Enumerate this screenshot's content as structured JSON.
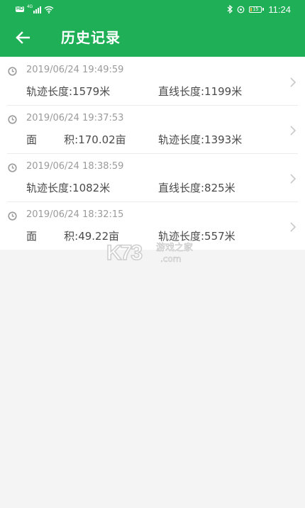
{
  "statusbar": {
    "left_icons": [
      "hd-badge",
      "4g-signal-icon",
      "wifi-icon"
    ],
    "hd_label": "HD",
    "network_label": "4G",
    "right_icons": [
      "bluetooth-icon",
      "location-icon",
      "battery-icon"
    ],
    "battery_level": "15",
    "battery_fraction": 0.15,
    "battery_color": "#f2b84b",
    "time": "11:24"
  },
  "appbar": {
    "back_icon": "arrow-left-icon",
    "title": "历史记录",
    "background": "#1faf57"
  },
  "records": [
    {
      "timestamp": "2019/06/24 19:49:59",
      "field1": "轨迹长度:1579米",
      "field2": "直线长度:1199米"
    },
    {
      "timestamp": "2019/06/24 19:37:53",
      "field1": "面        积:170.02亩",
      "field2": "轨迹长度:1393米"
    },
    {
      "timestamp": "2019/06/24 18:38:59",
      "field1": "轨迹长度:1082米",
      "field2": "直线长度:825米"
    },
    {
      "timestamp": "2019/06/24 18:32:15",
      "field1": "面        积:49.22亩",
      "field2": "轨迹长度:557米"
    }
  ],
  "watermark": {
    "logo": "K73",
    "site_name": "游戏之家",
    "domain": ".com"
  }
}
